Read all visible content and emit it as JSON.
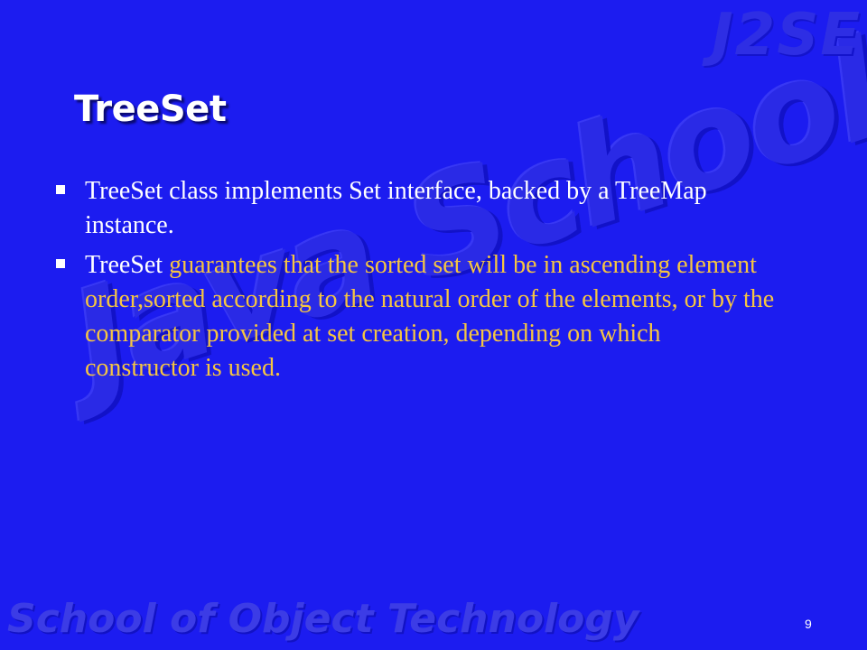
{
  "slide": {
    "title": "TreeSet",
    "page_number": "9",
    "bullets": [
      {
        "plain": "TreeSet class implements Set interface, backed by a TreeMap instance."
      },
      {
        "plain": "TreeSet",
        "highlight": " guarantees that the sorted set will be in ascending element order,sorted according to the natural order of the elements, or by the comparator provided at set creation, depending on which constructor is used."
      }
    ]
  },
  "watermarks": {
    "logo": "Java School",
    "brand": "J2SE",
    "footer": "School of Object Technology"
  },
  "colors": {
    "background": "#1c1cf0",
    "title": "#ffffff",
    "text": "#ffffff",
    "highlight": "#f5c542"
  }
}
